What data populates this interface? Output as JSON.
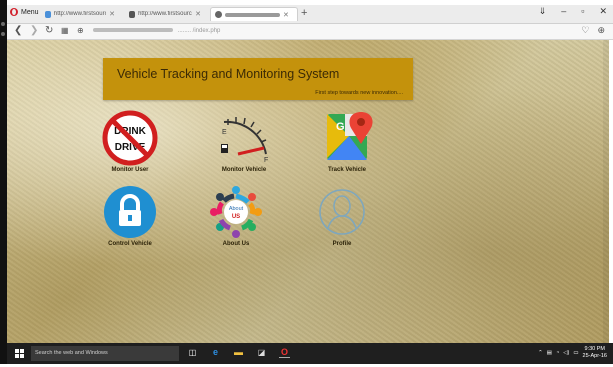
{
  "browser": {
    "menu_label": "Menu",
    "tabs": [
      {
        "title": "http://www.firstsource...",
        "active": false
      },
      {
        "title": "http://www.firstsource...",
        "active": false
      },
      {
        "title": "",
        "active": true
      }
    ],
    "url": "........ /index.php",
    "window_controls": [
      "‒",
      "–",
      "▢",
      "✕"
    ]
  },
  "page": {
    "title": "Vehicle Tracking and Monitoring System",
    "subtitle": "First step towards new innovation....",
    "tiles": [
      {
        "label": "Monitor User",
        "icon": "no-drink-drive-icon"
      },
      {
        "label": "Monitor Vehicle",
        "icon": "fuel-gauge-icon"
      },
      {
        "label": "Track Vehicle",
        "icon": "google-maps-icon"
      },
      {
        "label": "Control Vehicle",
        "icon": "lock-icon"
      },
      {
        "label": "About Us",
        "icon": "about-us-people-icon"
      },
      {
        "label": "Profile",
        "icon": "profile-icon"
      }
    ],
    "no_drink_text_top": "DRINK",
    "no_drink_text_bottom": "DRIVE",
    "about_text_top": "About",
    "about_text_bottom": "US"
  },
  "taskbar": {
    "search_placeholder": "Search the web and Windows",
    "time": "9:30 PM",
    "date": "25-Apr-16"
  },
  "colors": {
    "banner": "#c4920c",
    "lock_blue": "#1f8fd1",
    "no_sign_red": "#d11f1f"
  }
}
